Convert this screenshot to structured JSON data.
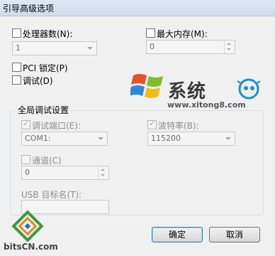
{
  "window": {
    "title": "引导高级选项"
  },
  "processors": {
    "label": "处理器数(N):",
    "value": "1"
  },
  "max_memory": {
    "label": "最大内存(M):",
    "value": "0"
  },
  "pci_lock": {
    "label": "PCI 锁定(P)"
  },
  "debug": {
    "label": "调试(D)"
  },
  "global_debug": {
    "title": "全局调试设置",
    "debug_port": {
      "label": "调试端口(E):",
      "value": "COM1:"
    },
    "baud_rate": {
      "label": "波特率(B):",
      "value": "115200"
    },
    "channel": {
      "label": "通道(C)",
      "value": "0"
    },
    "usb_target": {
      "label": "USB 目标名(T):",
      "value": ""
    }
  },
  "buttons": {
    "ok": "确定",
    "cancel": "取消"
  },
  "watermarks": {
    "xitong_logo": "系统",
    "xitong_url": "www.xitong8.com",
    "bitscn": "bitsCN.com"
  },
  "colors": {
    "accent": "#3c7fb1",
    "titlebar": "#dfe8f3"
  }
}
